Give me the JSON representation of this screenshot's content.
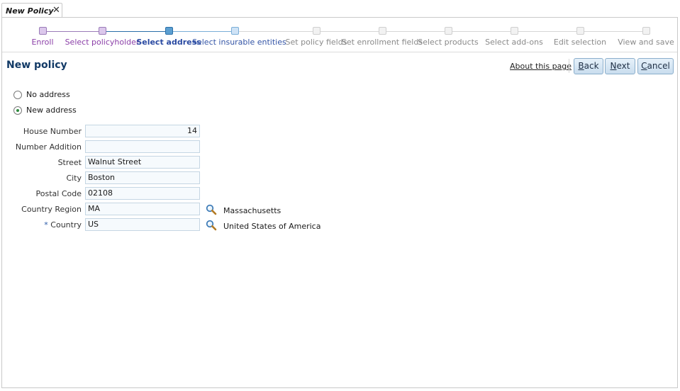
{
  "tab": {
    "title": "New Policy",
    "close_glyph": "✕"
  },
  "train": {
    "steps": [
      {
        "label": "Enroll",
        "state": "visited"
      },
      {
        "label": "Select policyholder",
        "state": "visited"
      },
      {
        "label": "Select address",
        "state": "current"
      },
      {
        "label": "Select insurable entities",
        "state": "next"
      },
      {
        "label": "Set policy fields",
        "state": "disabled"
      },
      {
        "label": "Set enrollment fields",
        "state": "disabled"
      },
      {
        "label": "Select products",
        "state": "disabled"
      },
      {
        "label": "Select add-ons",
        "state": "disabled"
      },
      {
        "label": "Edit selection",
        "state": "disabled"
      },
      {
        "label": "View and save",
        "state": "disabled"
      }
    ]
  },
  "header": {
    "title": "New policy",
    "about_link": "About this page",
    "buttons": {
      "back": {
        "first": "B",
        "rest": "ack"
      },
      "next": {
        "first": "N",
        "rest": "ext"
      },
      "cancel": {
        "first": "C",
        "rest": "ancel"
      }
    }
  },
  "address_choice": {
    "options": [
      {
        "label": "No address",
        "selected": false
      },
      {
        "label": "New address",
        "selected": true
      }
    ]
  },
  "form": {
    "fields": {
      "house_number": {
        "label": "House Number",
        "value": "14"
      },
      "number_addition": {
        "label": "Number Addition",
        "value": ""
      },
      "street": {
        "label": "Street",
        "value": "Walnut Street"
      },
      "city": {
        "label": "City",
        "value": "Boston"
      },
      "postal_code": {
        "label": "Postal Code",
        "value": "02108"
      },
      "country_region": {
        "label": "Country Region",
        "value": "MA",
        "description": "Massachusetts"
      },
      "country": {
        "label": "Country",
        "value": "US",
        "description": "United States of America",
        "required_marker": "*"
      }
    }
  },
  "icons": {
    "lookup": "magnifier-icon"
  },
  "colors": {
    "visited": "#8b3fa8",
    "current": "#2a4aa2",
    "title": "#123a66",
    "radio_selected": "#2d8a3d",
    "button_border": "#8aaecb"
  }
}
